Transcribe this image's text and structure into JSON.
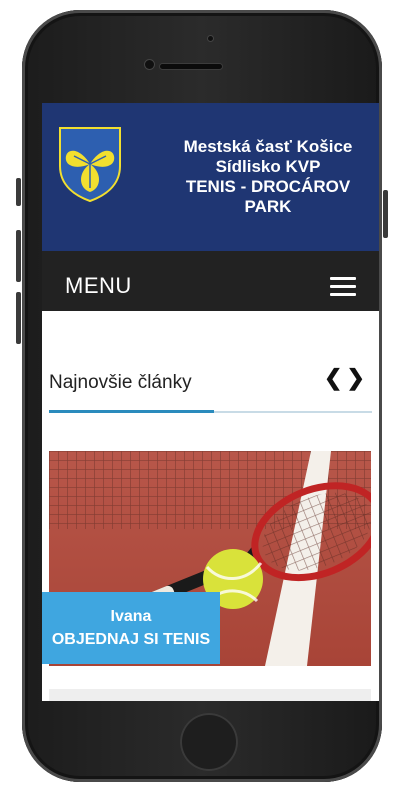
{
  "header": {
    "title_lines": [
      "Mestská časť Košice",
      "Sídlisko KVP",
      "TENIS - DROCÁROV",
      "PARK"
    ]
  },
  "menu": {
    "label": "MENU"
  },
  "section": {
    "title": "Najnovšie články"
  },
  "cta": {
    "line1": "Ivana",
    "line2": "OBJEDNAJ SI TENIS"
  },
  "icons": {
    "crest": "coat-of-arms-icon",
    "menu": "hamburger-icon",
    "prev": "chevron-left-icon",
    "next": "chevron-right-icon"
  },
  "colors": {
    "header_bg": "#1f3673",
    "menubar_bg": "#222222",
    "accent": "#2a8bbd",
    "cta_bg": "#3fa6e0",
    "crest_yellow": "#f2df2f",
    "crest_blue": "#2d5fb0"
  }
}
